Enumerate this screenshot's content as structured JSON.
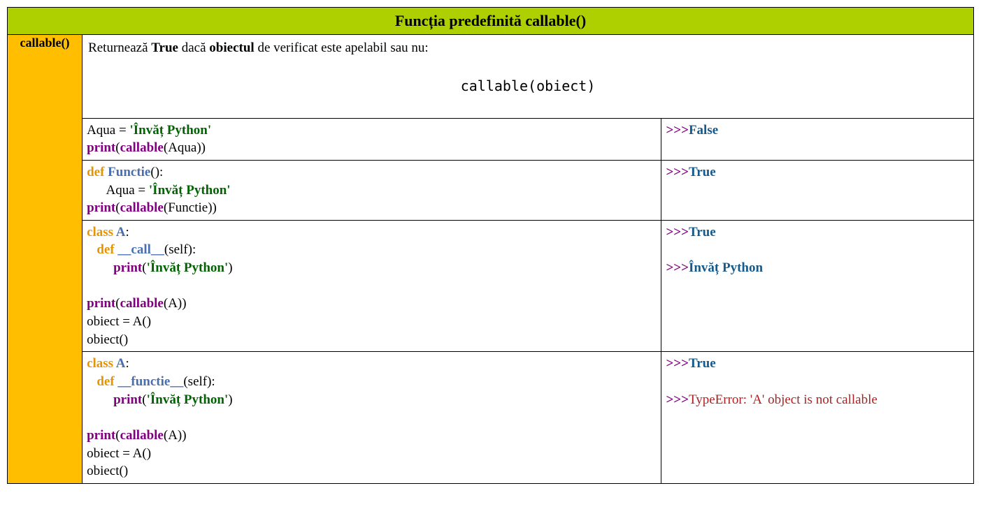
{
  "header": {
    "title": "Funcția predefinită callable()"
  },
  "side": {
    "label": "callable()"
  },
  "desc": {
    "t1": "Returnează ",
    "b1": "True",
    "t2": " dacă ",
    "b2": "obiectul",
    "t3": " de verificat este apelabil sau nu:",
    "signature": "callable(obiect)"
  },
  "ex1": {
    "c": {
      "l1a": "Aqua = ",
      "l1s": "'Învăț Python'",
      "l2p": "print",
      "l2o": "(",
      "l2b": "callable",
      "l2ar": "(Aqua))"
    },
    "o": {
      "p1": ">>>",
      "v1": "False"
    }
  },
  "ex2": {
    "c": {
      "l1d": "def ",
      "l1f": "Functie",
      "l1r": "():",
      "l2i": "      Aqua = ",
      "l2s": "'Învăț Python'",
      "l3p": "print",
      "l3o": "(",
      "l3b": "callable",
      "l3ar": "(Functie))"
    },
    "o": {
      "p1": ">>>",
      "v1": "True"
    }
  },
  "ex3": {
    "c": {
      "l1c": "class ",
      "l1n": "A",
      "l1r": ":",
      "l2i": "   ",
      "l2d": "def ",
      "l2f": "__call__",
      "l2r": "(self):",
      "l3i": "        ",
      "l3p": "print",
      "l3o": "(",
      "l3s": "'Învăț Python'",
      "l3c": ")",
      "l4p": "print",
      "l4o": "(",
      "l4b": "callable",
      "l4ar": "(A))",
      "l5": "obiect = A()",
      "l6": "obiect()"
    },
    "o": {
      "p1": ">>>",
      "v1": "True",
      "p2": ">>>",
      "v2": "Învăț Python"
    }
  },
  "ex4": {
    "c": {
      "l1c": "class ",
      "l1n": "A",
      "l1r": ":",
      "l2i": "   ",
      "l2d": "def ",
      "l2f": "__functie__",
      "l2r": "(self):",
      "l3i": "        ",
      "l3p": "print",
      "l3o": "(",
      "l3s": "'Învăț Python'",
      "l3c": ")",
      "l4p": "print",
      "l4o": "(",
      "l4b": "callable",
      "l4ar": "(A))",
      "l5": "obiect = A()",
      "l6": "obiect()"
    },
    "o": {
      "p1": ">>>",
      "v1": "True",
      "p2": ">>>",
      "e2": "TypeError: 'A' object is not callable"
    }
  }
}
